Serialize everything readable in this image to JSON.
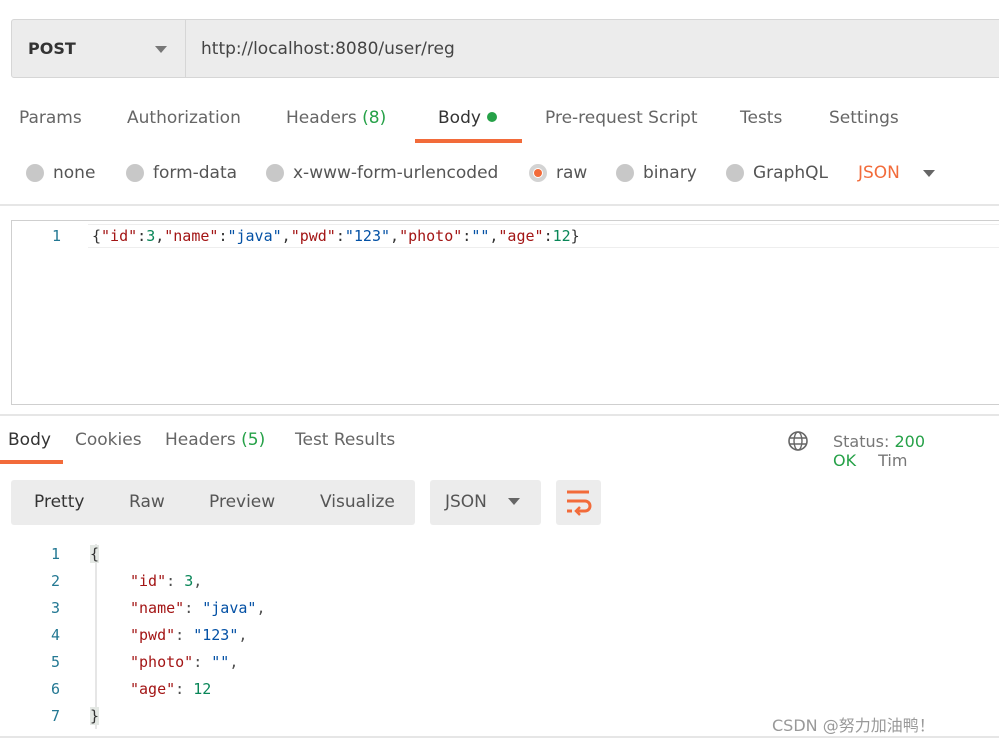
{
  "request": {
    "method": "POST",
    "url": "http://localhost:8080/user/reg"
  },
  "request_tabs": [
    {
      "label": "Params"
    },
    {
      "label": "Authorization"
    },
    {
      "label": "Headers",
      "count": "(8)"
    },
    {
      "label": "Body",
      "active": true
    },
    {
      "label": "Pre-request Script"
    },
    {
      "label": "Tests"
    },
    {
      "label": "Settings"
    }
  ],
  "body_types": [
    "none",
    "form-data",
    "x-www-form-urlencoded",
    "raw",
    "binary",
    "GraphQL"
  ],
  "selected_body_type": "raw",
  "body_format": "JSON",
  "request_body": {
    "line": "1",
    "text": "{\"id\":3,\"name\":\"java\",\"pwd\":\"123\",\"photo\":\"\",\"age\":12}"
  },
  "response_tabs": [
    {
      "label": "Body",
      "active": true
    },
    {
      "label": "Cookies"
    },
    {
      "label": "Headers",
      "count": "(5)"
    },
    {
      "label": "Test Results"
    }
  ],
  "status": {
    "label": "Status:",
    "value": "200 OK",
    "time_label": "Tim"
  },
  "view_modes": [
    "Pretty",
    "Raw",
    "Preview",
    "Visualize"
  ],
  "response_format": "JSON",
  "response_lines": [
    "1",
    "2",
    "3",
    "4",
    "5",
    "6",
    "7"
  ],
  "response_body": {
    "id": "3",
    "name": "\"java\"",
    "pwd": "\"123\"",
    "photo": "\"\"",
    "age": "12"
  },
  "watermark": "CSDN @努力加油鸭！",
  "colors": {
    "accent": "#f26b3a",
    "success": "#26a148"
  }
}
